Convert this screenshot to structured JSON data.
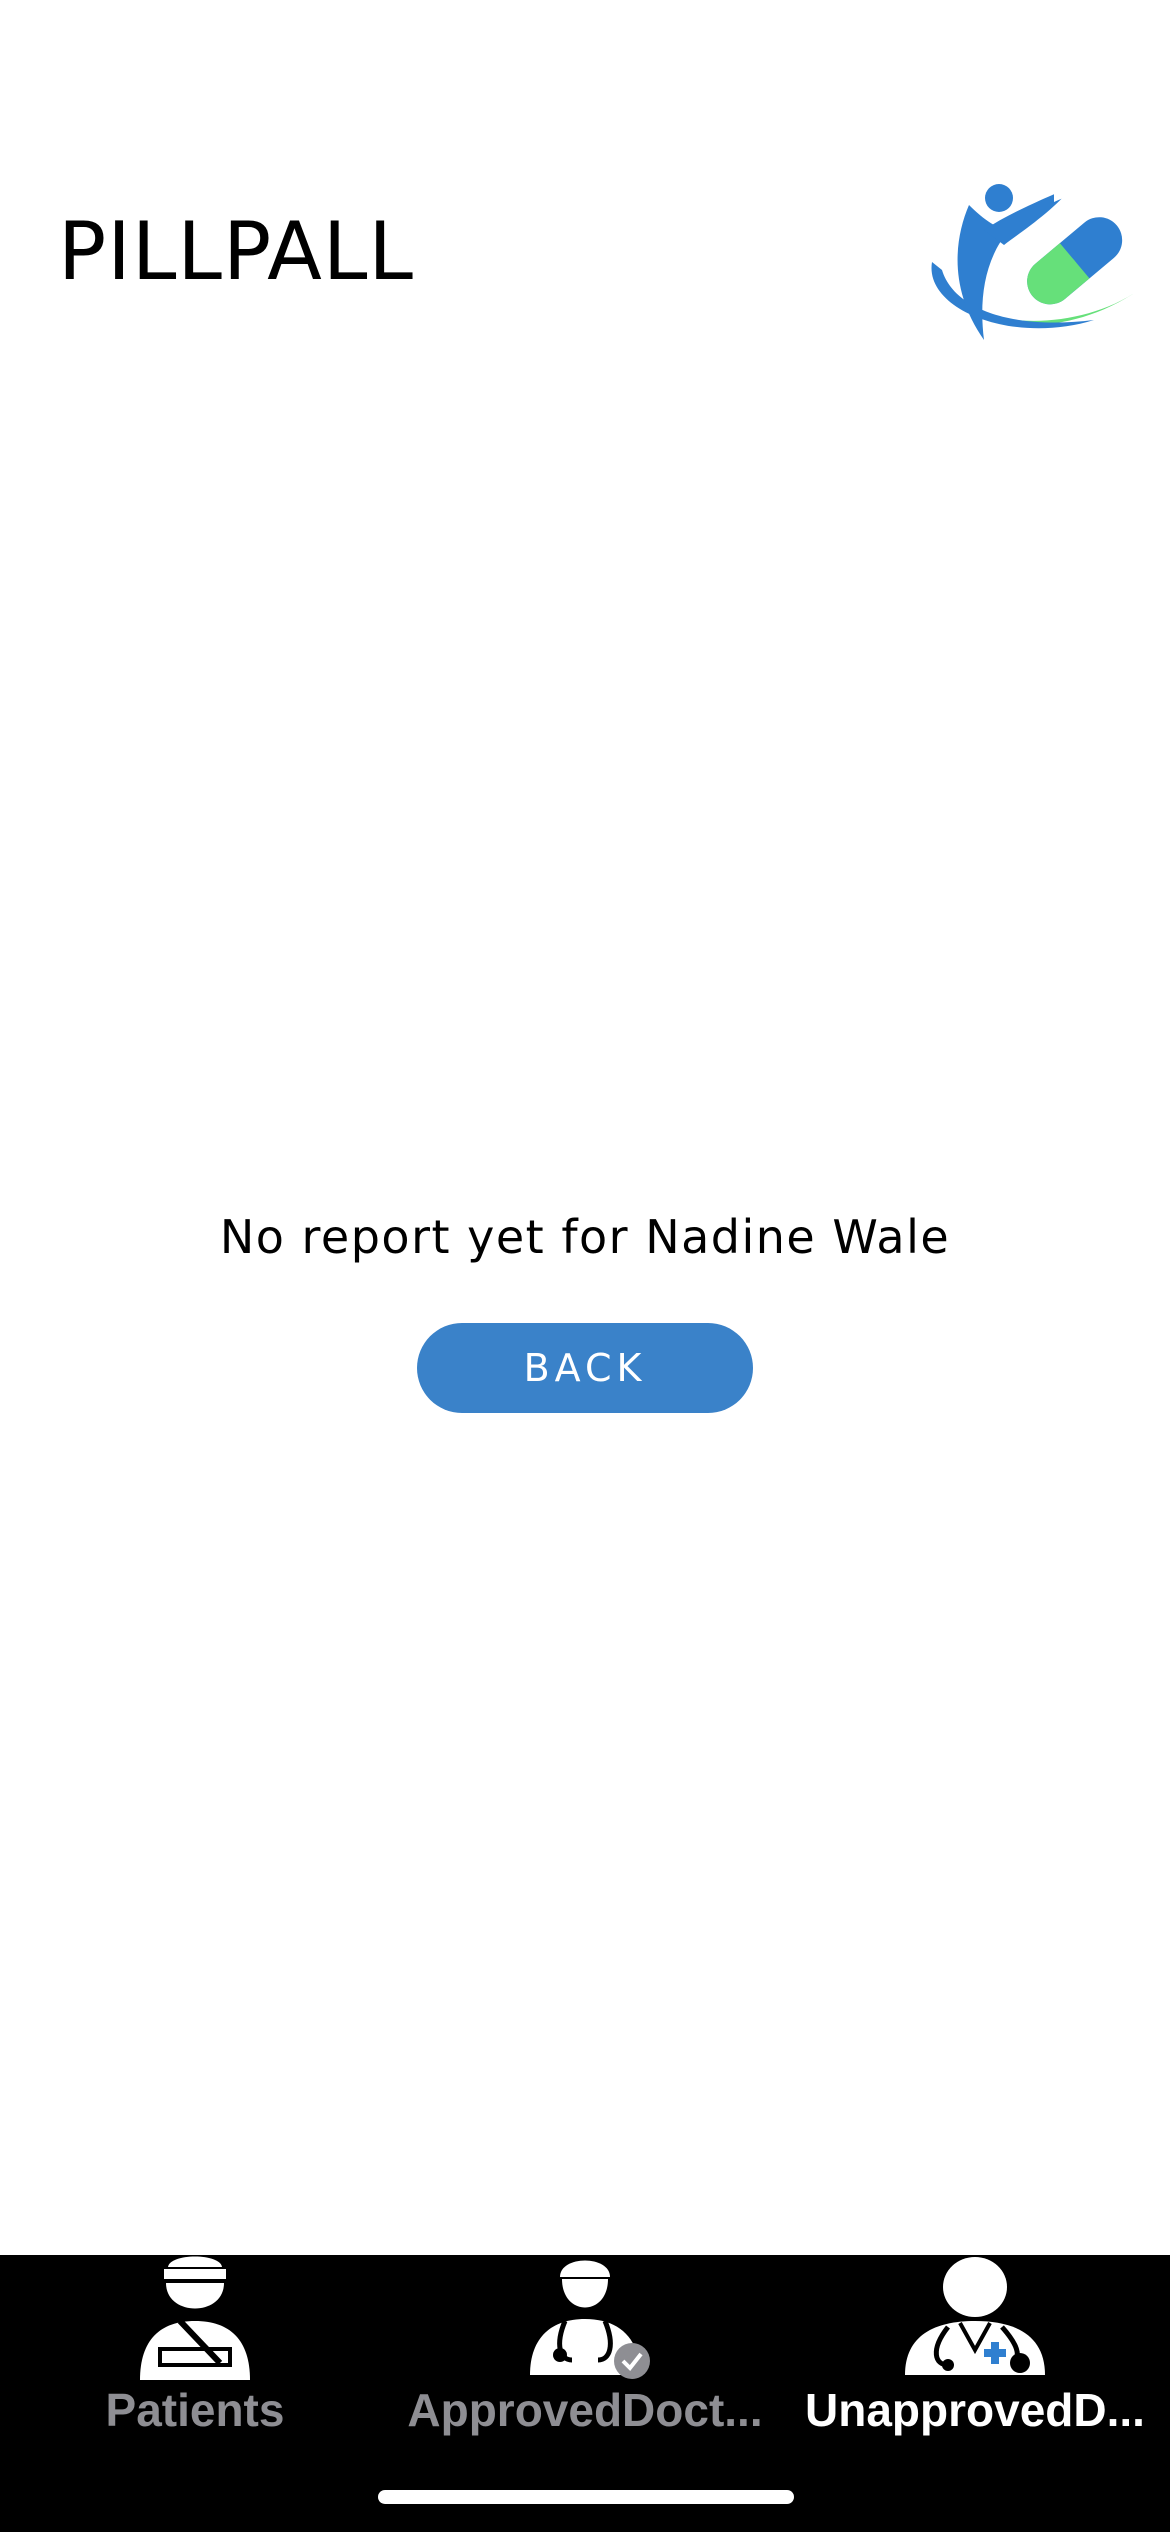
{
  "app": {
    "title": "PILLPALL",
    "logo_icon": "pillpall-logo-icon"
  },
  "report": {
    "message": "No report yet for Nadine Wale",
    "back_label": "BACK"
  },
  "tabs": [
    {
      "label": "Patients",
      "icon": "patient-icon",
      "active": false
    },
    {
      "label": "ApprovedDoct...",
      "icon": "approved-doctor-icon",
      "active": false
    },
    {
      "label": "UnapprovedD...",
      "icon": "unapproved-doctor-icon",
      "active": true
    }
  ],
  "colors": {
    "accent": "#3a82c9",
    "logo_blue": "#2f7fd0",
    "logo_green": "#66e07a",
    "tab_bar": "#000000",
    "tab_inactive": "#8e8e93",
    "tab_active": "#ffffff"
  }
}
